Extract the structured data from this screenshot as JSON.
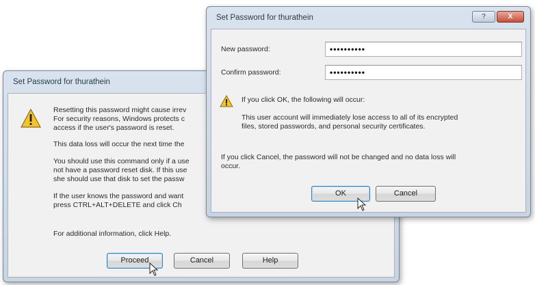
{
  "back_dialog": {
    "title": "Set Password for thurathein",
    "paragraphs": [
      "Resetting this password might cause irrev",
      "For security reasons, Windows protects c",
      "access if the user's password is reset.",
      "This data loss will occur the next time the",
      "You should use this command only if a use",
      "not have a password reset disk. If this use",
      "she should use that disk to set the passw",
      "If the user knows the password and want",
      "press CTRL+ALT+DELETE and click Ch",
      "For additional information, click Help."
    ],
    "buttons": {
      "proceed": "Proceed",
      "cancel": "Cancel",
      "help": "Help"
    }
  },
  "front_dialog": {
    "title": "Set Password for thurathein",
    "caption_buttons": {
      "help": "?",
      "close": "X"
    },
    "new_password_label": "New password:",
    "new_password_value": "••••••••••",
    "confirm_password_label": "Confirm password:",
    "confirm_password_value": "••••••••••",
    "ok_warning": "If you click OK, the following will occur:",
    "consequence_line1": "This user account will immediately lose access to all of its encrypted",
    "consequence_line2": "files, stored passwords, and personal security certificates.",
    "cancel_note_line1": "If you click Cancel, the password will not be changed and no data loss will",
    "cancel_note_line2": "occur.",
    "buttons": {
      "ok": "OK",
      "cancel": "Cancel"
    }
  },
  "icons": {
    "warning": "warning-icon",
    "cursor": "mouse-pointer-icon"
  },
  "colors": {
    "title_bar": "#d9e3ee",
    "client_bg": "#f1f1f1",
    "close_button": "#c7503b",
    "warning_yellow": "#f2c42f"
  }
}
